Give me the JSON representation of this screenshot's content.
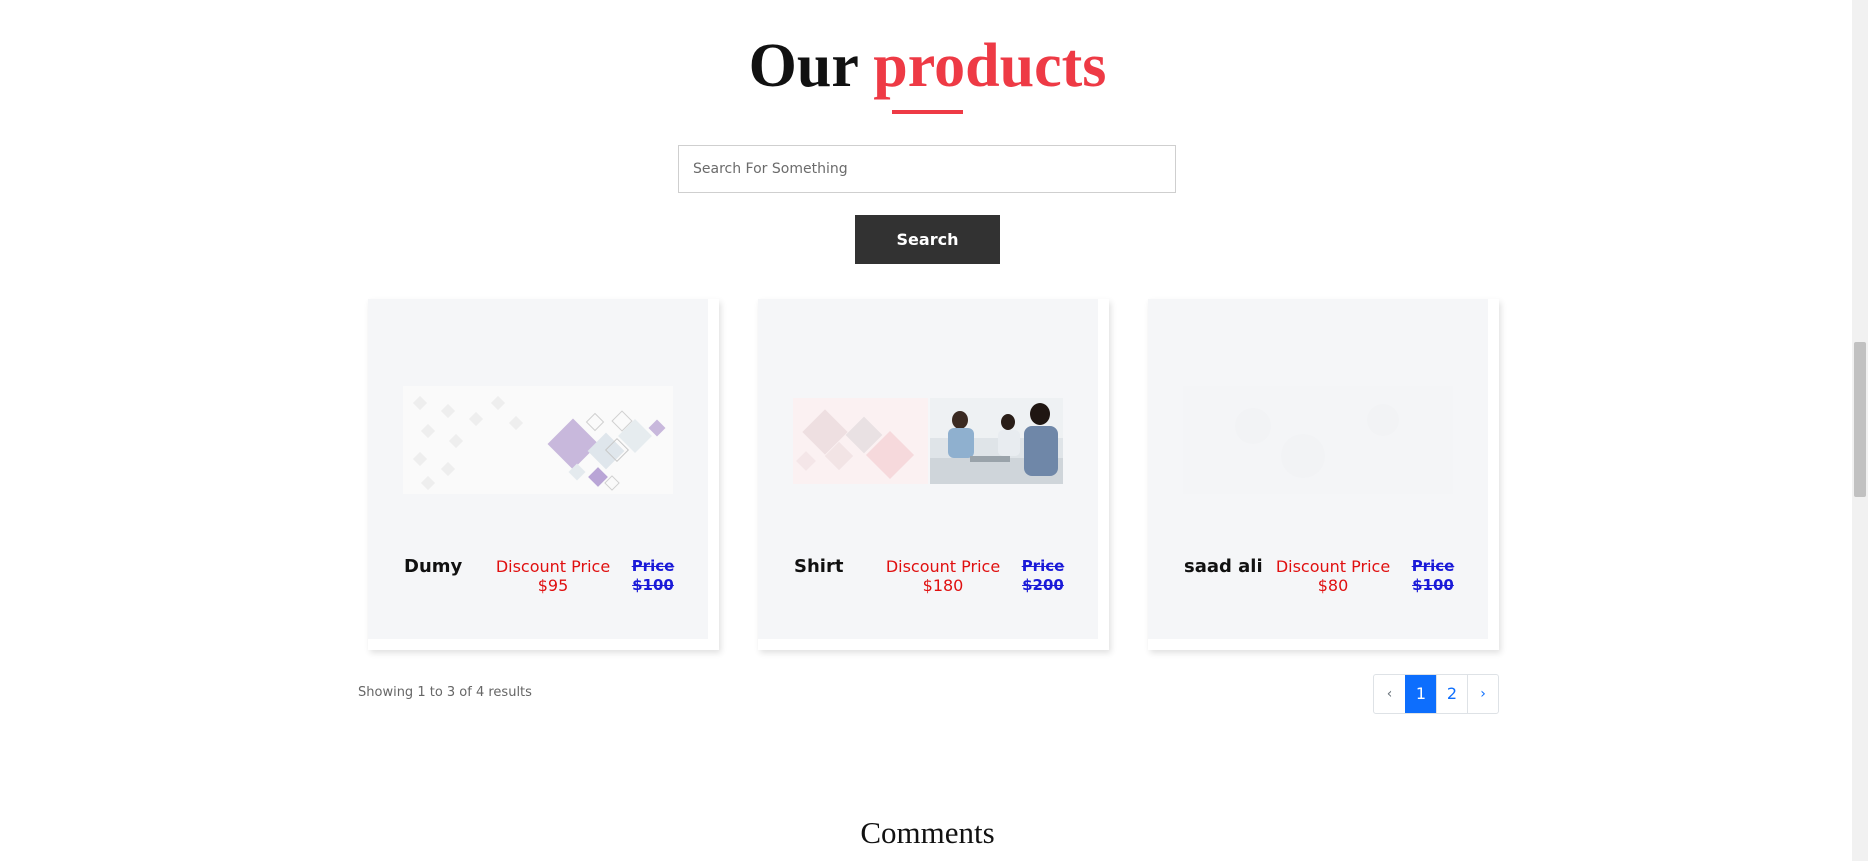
{
  "header": {
    "title_part1": "Our",
    "title_part2": "products",
    "accent_color": "#ee3a45"
  },
  "search": {
    "placeholder": "Search For Something",
    "value": "",
    "button_label": "Search"
  },
  "products": [
    {
      "name": "Dumy",
      "discount_label": "Discount Price",
      "discount_value": "$95",
      "price_label": "Price",
      "price_value": "$100",
      "image": "geometric-banner"
    },
    {
      "name": "Shirt",
      "discount_label": "Discount Price",
      "discount_value": "$180",
      "price_label": "Price",
      "price_value": "$200",
      "image": "business-meeting-banner"
    },
    {
      "name": "saad ali",
      "discount_label": "Discount Price",
      "discount_value": "$80",
      "price_label": "Price",
      "price_value": "$100",
      "image": "faded-banner"
    }
  ],
  "pagination": {
    "summary": "Showing 1 to 3 of 4 results",
    "prev": "‹",
    "pages": [
      "1",
      "2"
    ],
    "active_page": "1",
    "next": "›",
    "active_color": "#0d6efd"
  },
  "comments": {
    "heading": "Comments"
  }
}
